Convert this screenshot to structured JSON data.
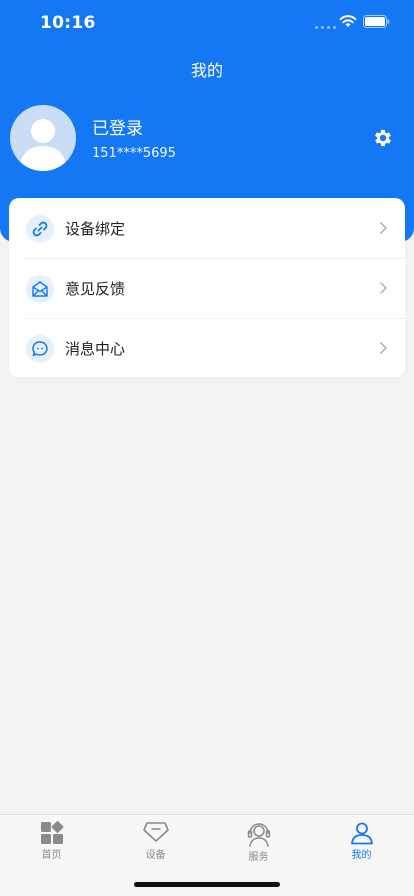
{
  "status_bar": {
    "time": "10:16"
  },
  "nav": {
    "title": "我的"
  },
  "profile": {
    "name": "已登录",
    "phone": "151****5695"
  },
  "menu": [
    {
      "label": "设备绑定",
      "icon": "link-icon"
    },
    {
      "label": "意见反馈",
      "icon": "mail-icon"
    },
    {
      "label": "消息中心",
      "icon": "chat-bubble-icon"
    }
  ],
  "tabs": [
    {
      "label": "首页",
      "icon": "grid-icon",
      "active": false
    },
    {
      "label": "设备",
      "icon": "device-icon",
      "active": false
    },
    {
      "label": "服务",
      "icon": "headset-icon",
      "active": false
    },
    {
      "label": "我的",
      "icon": "user-icon",
      "active": true
    }
  ],
  "colors": {
    "primary": "#1478f5",
    "background": "#f2f2f2",
    "inactive": "#8a8a8a"
  }
}
